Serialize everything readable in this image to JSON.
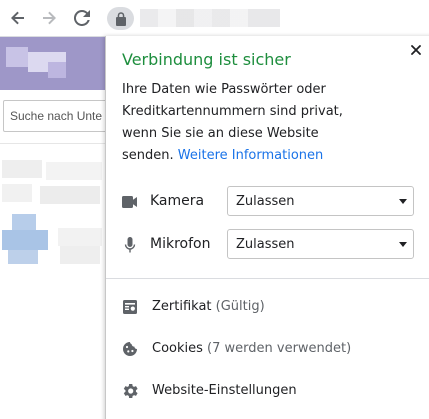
{
  "browser": {
    "toolbar_icons": [
      "back-arrow-icon",
      "forward-arrow-icon",
      "reload-icon",
      "lock-icon"
    ]
  },
  "page": {
    "search_placeholder": "Suche nach Unte"
  },
  "popup": {
    "title": "Verbindung ist sicher",
    "title_color": "#1e8e3e",
    "description": "Ihre Daten wie Passwörter oder Kreditkartennummern sind privat, wenn Sie sie an diese Website senden.",
    "link_text": "Weitere Informationen",
    "link_color": "#1a73e8",
    "permissions": [
      {
        "label": "Kamera",
        "value": "Zulassen",
        "icon": "camera-icon"
      },
      {
        "label": "Mikrofon",
        "value": "Zulassen",
        "icon": "microphone-icon"
      }
    ],
    "menu_items": [
      {
        "label": "Zertifikat",
        "sublabel": "(Gültig)",
        "icon": "certificate-icon"
      },
      {
        "label": "Cookies",
        "sublabel": "(7 werden verwendet)",
        "icon": "cookie-icon"
      },
      {
        "label": "Website-Einstellungen",
        "sublabel": "",
        "icon": "gear-icon"
      }
    ]
  }
}
